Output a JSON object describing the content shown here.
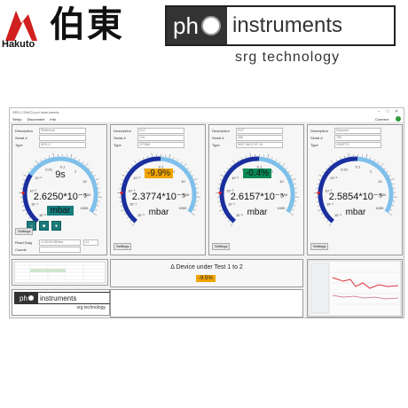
{
  "banner": {
    "hakuto_kanji": "伯東",
    "hakuto_word": "Hakuto",
    "ph_text": "ph",
    "instruments_text": "instruments",
    "srg_text": "srg technology"
  },
  "window": {
    "title": "SRG-CSA/CA-ph instruments",
    "menu": [
      "Setup",
      "Disconnect",
      "Info"
    ],
    "connect_label": "Connect",
    "connect_color": "#2e9a3a"
  },
  "panels": [
    {
      "fields": [
        {
          "label": "Description",
          "value": "Reference"
        },
        {
          "label": "Serial #",
          "value": ""
        },
        {
          "label": "Type",
          "value": "SRG-2"
        }
      ],
      "top": "9s",
      "value": "2.6250*10⁻⁵",
      "unit": "mbar",
      "gauge_fraction": 0.32,
      "settings": "Settings",
      "extra": {
        "read_diag_label": "Read Diag",
        "read_diag_value": "4.20245 05/Hea",
        "read_diag_opt": "A1",
        "counts_label": "Counts",
        "counts_value": ""
      }
    },
    {
      "fields": [
        {
          "label": "Description",
          "value": "DUT"
        },
        {
          "label": "Serial #",
          "value": "123"
        },
        {
          "label": "Type",
          "value": "CP25W"
        }
      ],
      "top": "-9.9%",
      "value": "2.3774*10⁻⁵",
      "unit": "mbar",
      "gauge_fraction": 0.55,
      "settings": "Settings"
    },
    {
      "fields": [
        {
          "label": "Description",
          "value": "DUT"
        },
        {
          "label": "Serial #",
          "value": "456"
        },
        {
          "label": "Type",
          "value": "NIST WKS OF XX"
        }
      ],
      "top": "-0.4%",
      "value": "2.6157*10⁻⁵",
      "unit": "mbar",
      "gauge_fraction": 0.55,
      "settings": "Settings"
    },
    {
      "fields": [
        {
          "label": "Description",
          "value": "Skyscore"
        },
        {
          "label": "Serial #",
          "value": "789"
        },
        {
          "label": "Type",
          "value": "VSMTTD"
        }
      ],
      "top": "",
      "value": "2.5854*10⁻⁵",
      "unit": "mbar",
      "gauge_fraction": 0.55,
      "settings": "Settings"
    }
  ],
  "gauge_ticks": [
    "10⁻⁵",
    "10⁻⁴",
    "10⁻³",
    "10⁻²",
    "0.01",
    "0.1",
    "1",
    "10",
    "100",
    "1000"
  ],
  "delta": {
    "title": "Δ Device under Test 1 to 2",
    "value": "-9.5%"
  },
  "colors": {
    "orange": "#f0a400",
    "green": "#0b8a55",
    "teal": "#167e7e",
    "gauge_dark": "#1a2e9e",
    "gauge_light": "#7fc0ea"
  }
}
